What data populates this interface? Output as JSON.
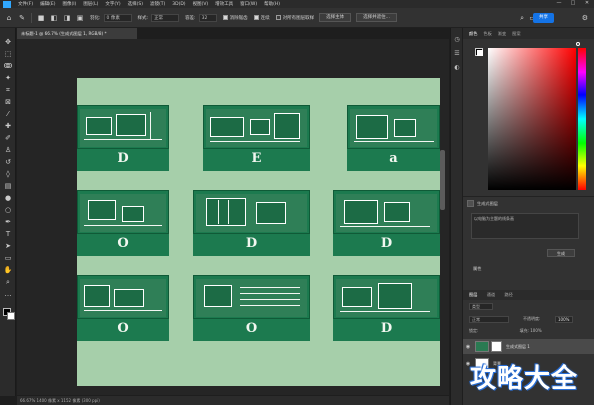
{
  "menubar": {
    "items": [
      "文件(F)",
      "编辑(E)",
      "图像(I)",
      "图层(L)",
      "文字(Y)",
      "选择(S)",
      "滤镜(T)",
      "3D(D)",
      "视图(V)",
      "增效工具",
      "窗口(W)",
      "帮助(H)"
    ],
    "window_controls": [
      "—",
      "□",
      "✕"
    ]
  },
  "options": {
    "feather_label": "羽化:",
    "feather_value": "0 像素",
    "style_label": "样式:",
    "style_value": "正常",
    "tolerance_label": "容差:",
    "tolerance_value": "32",
    "antialias_label": "消除锯齿",
    "contiguous_label": "连续",
    "sample_all_label": "对所有图层取样",
    "select_subject": "选择主体",
    "select_mask": "选择并遮住...",
    "share_label": "共享"
  },
  "document": {
    "tab_title": "未标题-1 @ 66.7% (生成式图层 1, RGB/8) *",
    "status": "66.67%   1400 像素 x 1152 像素 (300 ppi)"
  },
  "cards": [
    {
      "glyph": "D"
    },
    {
      "glyph": "E"
    },
    {
      "glyph": "a"
    },
    {
      "glyph": "O"
    },
    {
      "glyph": "D"
    },
    {
      "glyph": "D"
    },
    {
      "glyph": "O"
    },
    {
      "glyph": "O"
    },
    {
      "glyph": "D"
    }
  ],
  "right_panel": {
    "tabs": [
      "颜色",
      "色板",
      "渐变",
      "图案"
    ],
    "gen_section_title": "生成式图层",
    "prompt_text": "以电脑为主题的线条画",
    "generate_label": "生成",
    "properties_label": "属性"
  },
  "layers": {
    "tabs": [
      "图层",
      "通道",
      "路径"
    ],
    "kind_filter": "类型",
    "blend_mode": "正常",
    "opacity_label": "不透明度:",
    "opacity_value": "100%",
    "lock_label": "锁定:",
    "fill_label": "填充: 100%",
    "rows": [
      {
        "name": "生成式图层 1",
        "selected": true,
        "thumb_color": "#2a7a52"
      },
      {
        "name": "背景",
        "selected": false,
        "thumb_color": "#ffffff"
      }
    ]
  },
  "watermark": "攻略大全",
  "colors": {
    "artboard_bg": "#a6cfaa",
    "card_green": "#1c7a4f",
    "share_blue": "#1473e6"
  }
}
